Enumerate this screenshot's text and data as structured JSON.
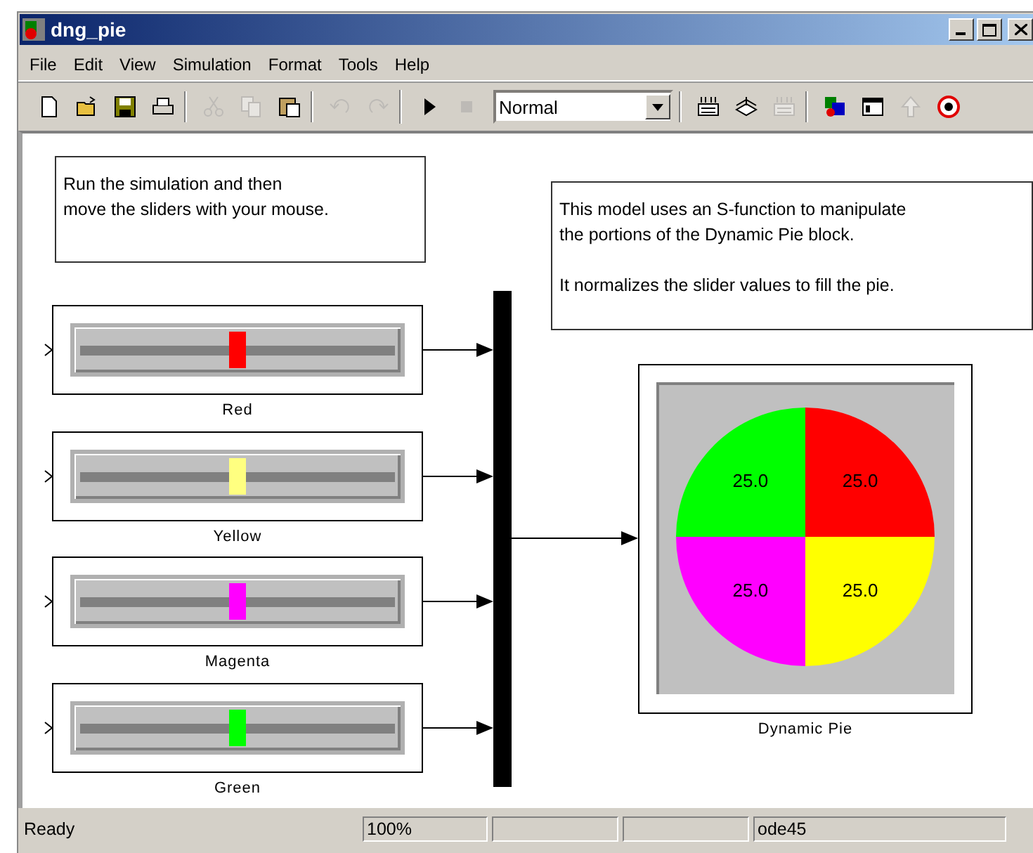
{
  "window": {
    "title": "dng_pie"
  },
  "menu": [
    "File",
    "Edit",
    "View",
    "Simulation",
    "Format",
    "Tools",
    "Help"
  ],
  "toolbar": {
    "groups": [
      {
        "items": [
          {
            "kind": "new",
            "disabled": false
          },
          {
            "kind": "open",
            "disabled": false
          },
          {
            "kind": "save",
            "disabled": false
          },
          {
            "kind": "print",
            "disabled": false
          }
        ]
      },
      {
        "items": [
          {
            "kind": "cut",
            "disabled": true
          },
          {
            "kind": "copy",
            "disabled": true
          },
          {
            "kind": "paste",
            "disabled": false
          }
        ]
      },
      {
        "items": [
          {
            "kind": "undo",
            "disabled": true
          },
          {
            "kind": "redo",
            "disabled": true
          }
        ]
      },
      {
        "items": [
          {
            "kind": "start",
            "disabled": false
          },
          {
            "kind": "stop",
            "disabled": true
          },
          {
            "kind": "mode-select",
            "value": "Normal",
            "disabled": false
          }
        ]
      },
      {
        "items": [
          {
            "kind": "update",
            "disabled": false
          },
          {
            "kind": "build",
            "disabled": false
          },
          {
            "kind": "update",
            "disabled": true
          }
        ]
      },
      {
        "items": [
          {
            "kind": "library",
            "disabled": false
          },
          {
            "kind": "browser",
            "disabled": false
          },
          {
            "kind": "up",
            "disabled": true
          },
          {
            "kind": "debug",
            "disabled": false
          }
        ]
      }
    ]
  },
  "notes": [
    {
      "paragraphs": [
        {
          "lines": [
            "Run the simulation and then",
            "move the sliders with your mouse."
          ]
        }
      ]
    },
    {
      "paragraphs": [
        {
          "lines": [
            "This model uses an S-function to manipulate",
            "the portions of the Dynamic Pie block."
          ]
        },
        {
          "lines": [
            "It normalizes the slider values to fill the pie."
          ]
        }
      ]
    }
  ],
  "sliders": [
    {
      "name": "Red",
      "level": 0.5,
      "color": "#ff0000"
    },
    {
      "name": "Yellow",
      "level": 0.5,
      "color": "#ffff80"
    },
    {
      "name": "Magenta",
      "level": 0.5,
      "color": "#ff00ff"
    },
    {
      "name": "Green",
      "level": 0.5,
      "color": "#00ff00"
    }
  ],
  "pie_block": {
    "name": "Dynamic Pie",
    "slices": [
      {
        "color": "#ff0000"
      },
      {
        "color": "#ffff00"
      },
      {
        "color": "#ff00ff"
      },
      {
        "color": "#00ff00"
      }
    ],
    "chart_data": {
      "type": "pie",
      "values": [
        25,
        25,
        25,
        25
      ],
      "value_labels": [
        "25.0",
        "25.0",
        "25.0",
        "25.0"
      ]
    }
  },
  "status_bar": {
    "message": "Ready",
    "zoom": "100%",
    "solver": "ode45"
  }
}
